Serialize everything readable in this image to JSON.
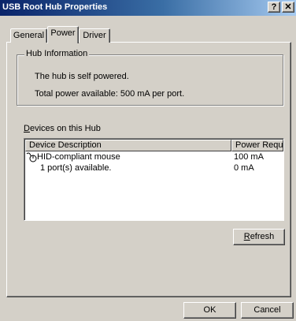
{
  "window": {
    "title": "USB Root Hub Properties",
    "help_glyph": "?",
    "close_glyph": "✕"
  },
  "tabs": [
    {
      "label": "General",
      "selected": false
    },
    {
      "label": "Power",
      "selected": true
    },
    {
      "label": "Driver",
      "selected": false
    }
  ],
  "hub_info": {
    "legend": "Hub Information",
    "self_powered_text": "The hub is self powered.",
    "total_power_text": "Total power available:  500 mA per port."
  },
  "devices": {
    "label_prefix": "D",
    "label_rest": "evices on this Hub",
    "columns": [
      "Device Description",
      "Power Required"
    ],
    "rows": [
      {
        "description": "HID-compliant mouse",
        "power": "100 mA",
        "icon": "mouse-icon"
      },
      {
        "description": "1 port(s) available.",
        "power": "0 mA",
        "icon": ""
      }
    ]
  },
  "buttons": {
    "refresh_prefix": "R",
    "refresh_rest": "efresh",
    "ok": "OK",
    "cancel": "Cancel"
  }
}
